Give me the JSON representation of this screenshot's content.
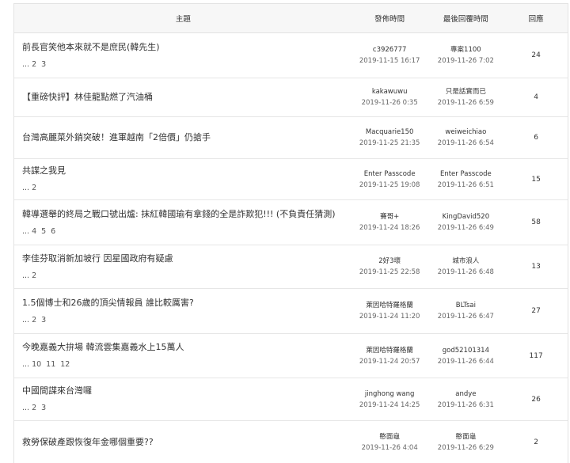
{
  "header": {
    "topic": "主題",
    "posted": "發佈時間",
    "last_reply": "最後回覆時間",
    "replies": "回應"
  },
  "threads": [
    {
      "title": "前長官笑他本來就不是庶民(韓先生)",
      "pages": [
        "2",
        "3"
      ],
      "author": "c3926777",
      "posted": "2019-11-15 16:17",
      "last_user": "專案1100",
      "last_time": "2019-11-26 7:02",
      "replies": "24"
    },
    {
      "title": "【重磅快評】林佳龍點燃了汽油桶",
      "pages": [],
      "author": "kakawuwu",
      "posted": "2019-11-26 0:35",
      "last_user": "只是話實而已",
      "last_time": "2019-11-26 6:59",
      "replies": "4"
    },
    {
      "title": "台灣高麗菜外銷突破！進軍越南「2倍價」仍搶手",
      "pages": [],
      "author": "Macquarie150",
      "posted": "2019-11-25 21:35",
      "last_user": "weiweichiao",
      "last_time": "2019-11-26 6:54",
      "replies": "6"
    },
    {
      "title": "共諜之我見",
      "pages": [
        "2"
      ],
      "author": "Enter Passcode",
      "posted": "2019-11-25 19:08",
      "last_user": "Enter Passcode",
      "last_time": "2019-11-26 6:51",
      "replies": "15"
    },
    {
      "title": "韓導選舉的終局之戰口號出爐: 抹紅韓國瑜有拿錢的全是詐欺犯!!! (不負責任猜測)",
      "pages": [
        "4",
        "5",
        "6"
      ],
      "author": "賽哥+",
      "posted": "2019-11-24 18:26",
      "last_user": "KingDavid520",
      "last_time": "2019-11-26 6:49",
      "replies": "58"
    },
    {
      "title": "李佳芬取消新加坡行 因星國政府有疑慮",
      "pages": [
        "2"
      ],
      "author": "2好3壞",
      "posted": "2019-11-25 22:58",
      "last_user": "城市浪人",
      "last_time": "2019-11-26 6:48",
      "replies": "13"
    },
    {
      "title": "1.5個博士和26歲的頂尖情報員 誰比較厲害?",
      "pages": [
        "2",
        "3"
      ],
      "author": "萊因哈特羅格蘭",
      "posted": "2019-11-24 11:20",
      "last_user": "BLTsai",
      "last_time": "2019-11-26 6:47",
      "replies": "27"
    },
    {
      "title": "今晚嘉義大拚場 韓流雲集嘉義水上15萬人",
      "pages": [
        "10",
        "11",
        "12"
      ],
      "author": "萊因哈特羅格蘭",
      "posted": "2019-11-24 20:57",
      "last_user": "god52101314",
      "last_time": "2019-11-26 6:44",
      "replies": "117"
    },
    {
      "title": "中國間諜來台灣囉",
      "pages": [
        "2",
        "3"
      ],
      "author": "jinghong wang",
      "posted": "2019-11-24 14:25",
      "last_user": "andye",
      "last_time": "2019-11-26 6:31",
      "replies": "26"
    },
    {
      "title": "救勞保破產跟恢復年金哪個重要??",
      "pages": [],
      "author": "憨面龜",
      "posted": "2019-11-26 4:04",
      "last_user": "憨面龜",
      "last_time": "2019-11-26 6:29",
      "replies": "2"
    }
  ],
  "pages_prefix": "..."
}
